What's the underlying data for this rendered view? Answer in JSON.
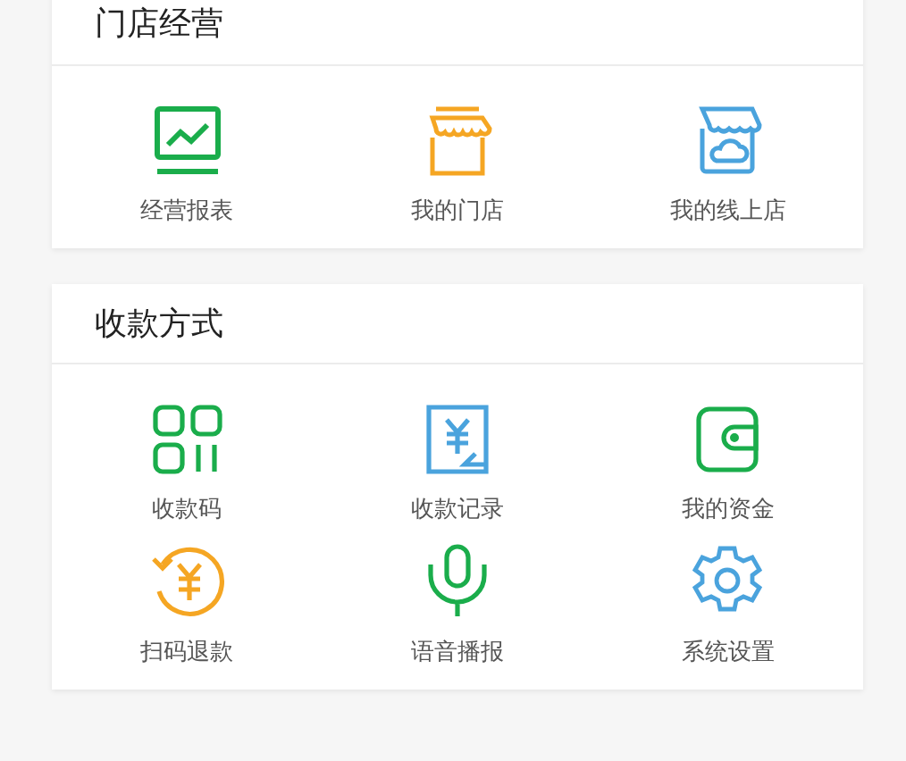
{
  "sections": [
    {
      "title": "门店经营",
      "items": [
        {
          "kind": "report",
          "label": "经营报表"
        },
        {
          "kind": "store",
          "label": "我的门店"
        },
        {
          "kind": "online-store",
          "label": "我的线上店"
        }
      ]
    },
    {
      "title": "收款方式",
      "items": [
        {
          "kind": "qr",
          "label": "收款码"
        },
        {
          "kind": "record",
          "label": "收款记录"
        },
        {
          "kind": "wallet",
          "label": "我的资金"
        },
        {
          "kind": "refund",
          "label": "扫码退款"
        },
        {
          "kind": "voice",
          "label": "语音播报"
        },
        {
          "kind": "settings",
          "label": "系统设置"
        }
      ]
    }
  ]
}
